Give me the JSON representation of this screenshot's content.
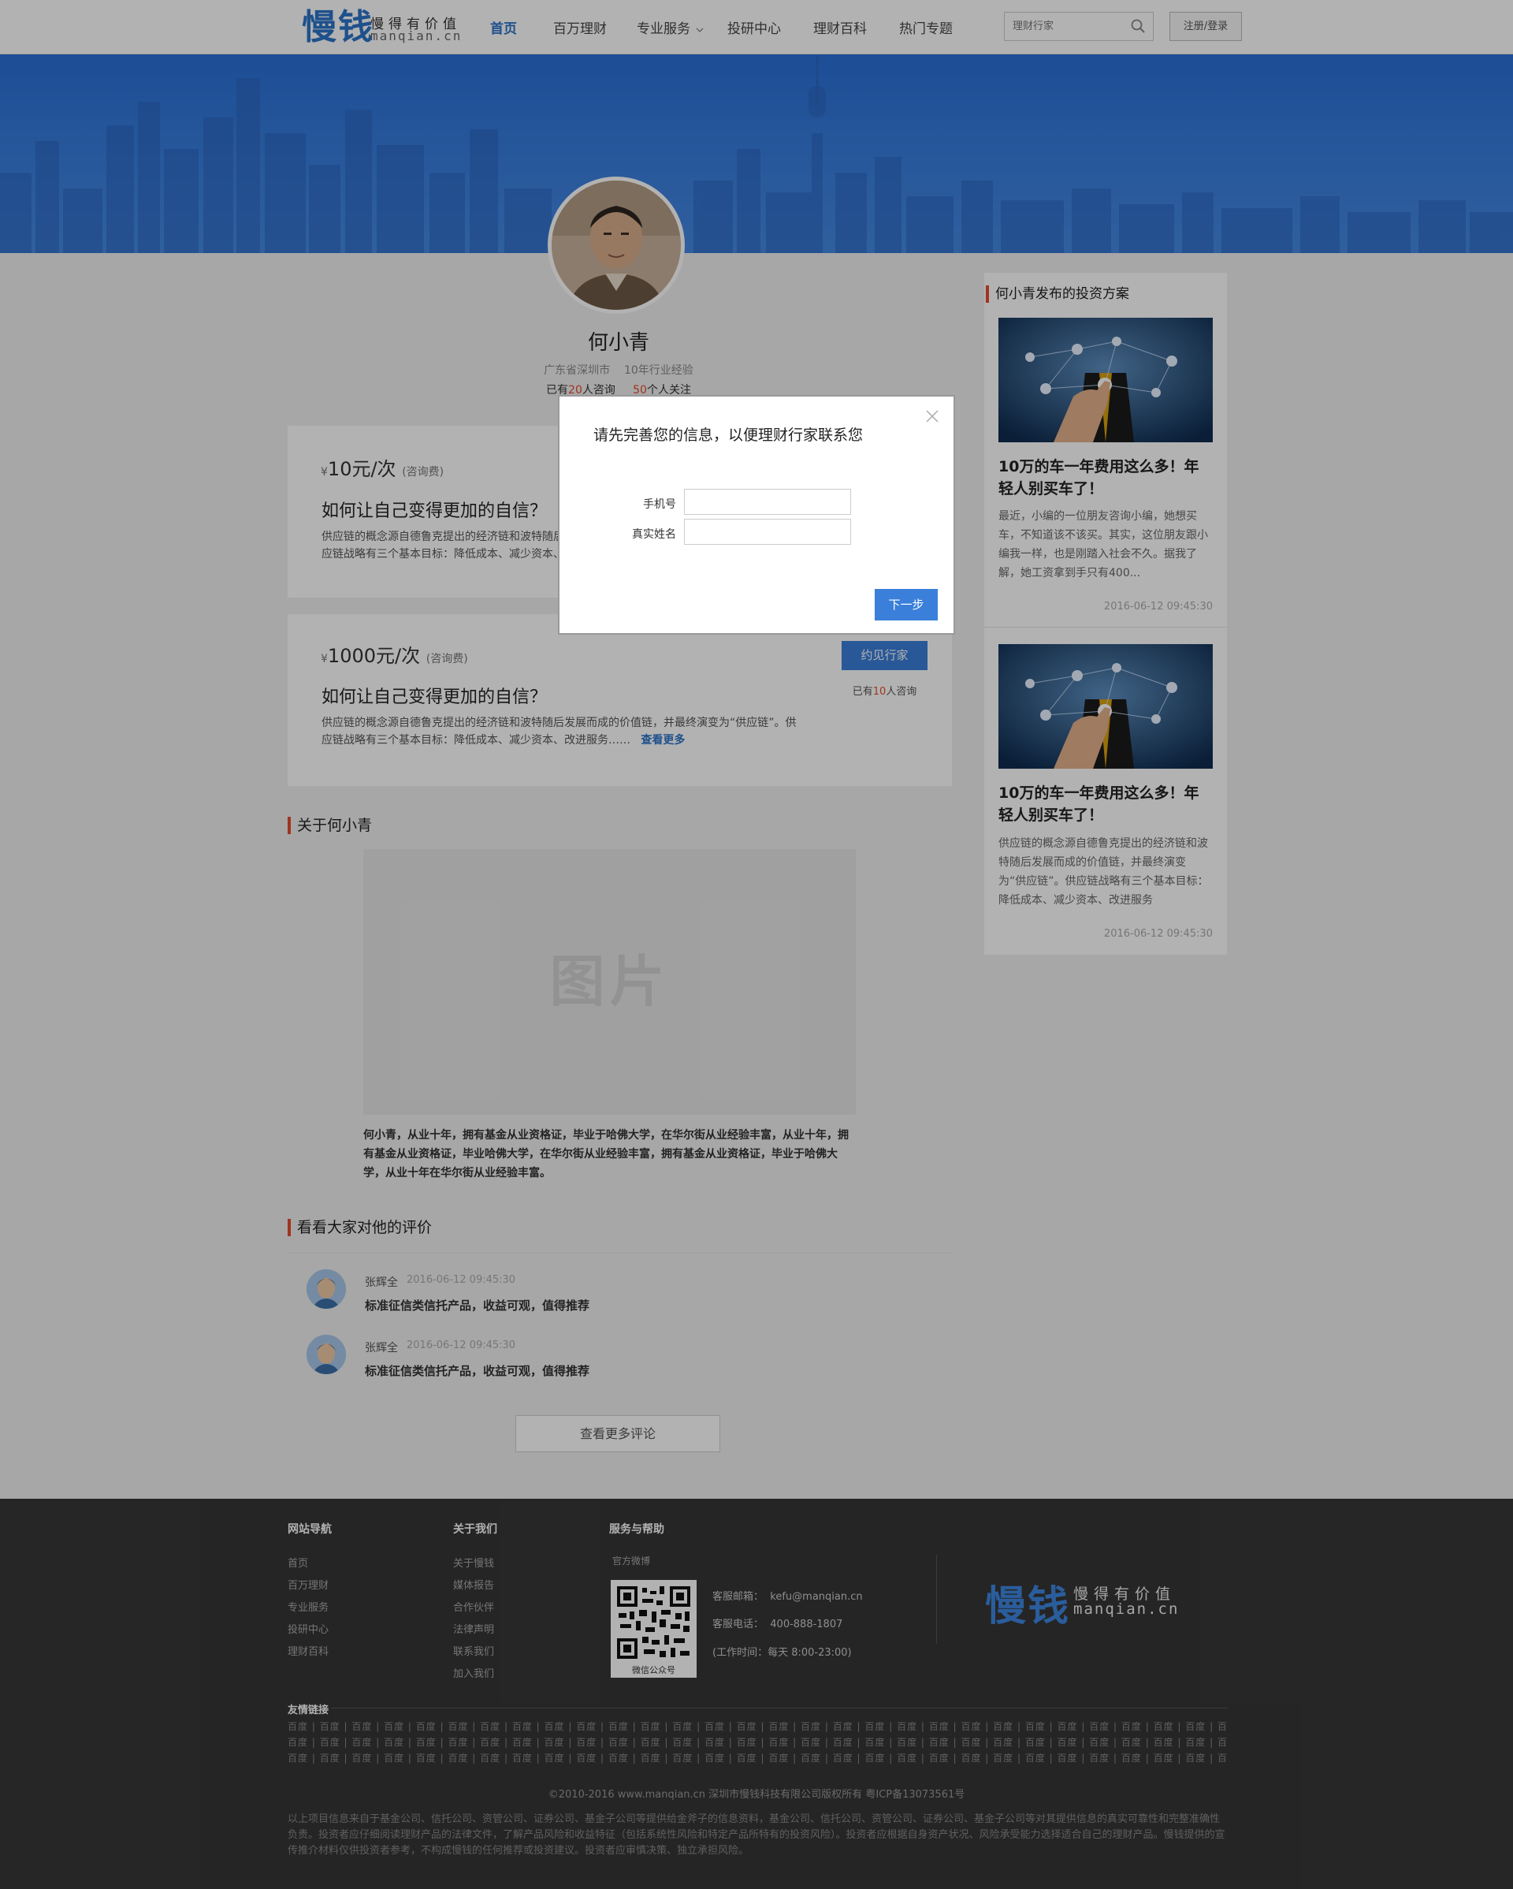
{
  "header": {
    "logo_main": "慢钱",
    "logo_slogan": "慢得有价值",
    "logo_domain": "manqian.cn",
    "nav": [
      {
        "label": "首页",
        "active": true
      },
      {
        "label": "百万理财",
        "active": false
      },
      {
        "label": "专业服务",
        "active": false,
        "dropdown": true
      },
      {
        "label": "投研中心",
        "active": false
      },
      {
        "label": "理财百科",
        "active": false
      },
      {
        "label": "热门专题",
        "active": false
      }
    ],
    "search_placeholder": "理财行家",
    "login_label": "注册/登录",
    "accent_color": "#2b74c9"
  },
  "profile": {
    "name": "何小青",
    "location": "广东省深圳市",
    "experience": "10年行业经验",
    "consult_prefix": "已有",
    "consult_count": "20",
    "consult_suffix": "人咨询",
    "follow_count": "50",
    "follow_suffix": "个人关注"
  },
  "services": [
    {
      "currency": "¥",
      "price": "10元",
      "unit": "/次",
      "fee_label": "(咨询费)",
      "title": "如何让自己变得更加的自信？",
      "desc": "供应链的概念源自德鲁克提出的经济链和波特随后发展而成的价值链，并最终演变为“供应链”。供应链战略有三个基本目标：降低成本、减少资本、改进服务……"
    },
    {
      "currency": "¥",
      "price": "1000元",
      "unit": "/次",
      "fee_label": "(咨询费)",
      "title": "如何让自己变得更加的自信？",
      "desc": "供应链的概念源自德鲁克提出的经济链和波特随后发展而成的价值链，并最终演变为“供应链”。供应链战略有三个基本目标：降低成本、减少资本、改进服务……",
      "more_label": "查看更多",
      "button_label": "约见行家",
      "count_prefix": "已有",
      "count": "10",
      "count_suffix": "人咨询"
    }
  ],
  "about": {
    "title": "关于何小青",
    "image_placeholder": "图片",
    "text": "何小青，从业十年，拥有基金从业资格证，毕业于哈佛大学，在华尔街从业经验丰富，从业十年，拥有基金从业资格证，毕业哈佛大学，在华尔街从业经验丰富，拥有基金从业资格证，毕业于哈佛大学，从业十年在华尔街从业经验丰富。"
  },
  "reviews": {
    "title": "看看大家对他的评价",
    "items": [
      {
        "name": "张辉全",
        "time": "2016-06-12 09:45:30",
        "text": "标准征信类信托产品，收益可观，值得推荐"
      },
      {
        "name": "张辉全",
        "time": "2016-06-12 09:45:30",
        "text": "标准征信类信托产品，收益可观，值得推荐"
      }
    ],
    "more_label": "查看更多评论"
  },
  "sidebar": {
    "title": "何小青发布的投资方案",
    "articles": [
      {
        "title": "10万的车一年费用这么多！年轻人别买车了！",
        "desc": "最近，小编的一位朋友咨询小编，她想买车，不知道该不该买。其实，这位朋友跟小编我一样，也是刚踏入社会不久。据我了解，她工资拿到手只有400...",
        "date": "2016-06-12 09:45:30"
      },
      {
        "title": "10万的车一年费用这么多！年轻人别买车了！",
        "desc": "供应链的概念源自德鲁克提出的经济链和波特随后发展而成的价值链，并最终演变为“供应链”。供应链战略有三个基本目标：降低成本、减少资本、改进服务",
        "date": "2016-06-12 09:45:30"
      }
    ]
  },
  "footer": {
    "nav_title": "网站导航",
    "nav_links": [
      "首页",
      "百万理财",
      "专业服务",
      "投研中心",
      "理财百科"
    ],
    "about_title": "关于我们",
    "about_links": [
      "关于慢钱",
      "媒体报告",
      "合作伙伴",
      "法律声明",
      "联系我们",
      "加入我们"
    ],
    "service_title": "服务与帮助",
    "weibo_label": "官方微博",
    "qr_caption": "微信公众号",
    "email_label": "客服邮箱：",
    "email": "kefu@manqian.cn",
    "phone_label": "客服电话：",
    "phone": "400-888-1807",
    "hours": "(工作时间：每天 8:00-23:00)",
    "logo_main": "慢钱",
    "logo_slogan": "慢得有价值",
    "logo_domain": "manqian.cn",
    "friend_links_title": "友情链接",
    "friend_link_text": "百度",
    "copyright": "©2010-2016 www.manqian.cn 深圳市慢钱科技有限公司版权所有   粤ICP备13073561号",
    "disclaimer": "以上项目信息来自于基金公司、信托公司、资管公司、证券公司、基金子公司等提供给金斧子的信息资料，基金公司、信托公司、资管公司、证券公司、基金子公司等对其提供信息的真实可靠性和完整准确性负责。投资者应仔细阅读理财产品的法律文件，了解产品风险和收益特征（包括系统性风险和特定产品所特有的投资风险）。投资者应根据自身资产状况、风险承受能力选择适合自己的理财产品。慢钱提供的宣传推介材料仅供投资者参考，不构成慢钱的任何推荐或投资建议。投资者应审慎决策、独立承担风险。"
  },
  "modal": {
    "title": "请先完善您的信息，以便理财行家联系您",
    "phone_label": "手机号",
    "name_label": "真实姓名",
    "phone_value": "",
    "name_value": "",
    "next_label": "下一步"
  }
}
